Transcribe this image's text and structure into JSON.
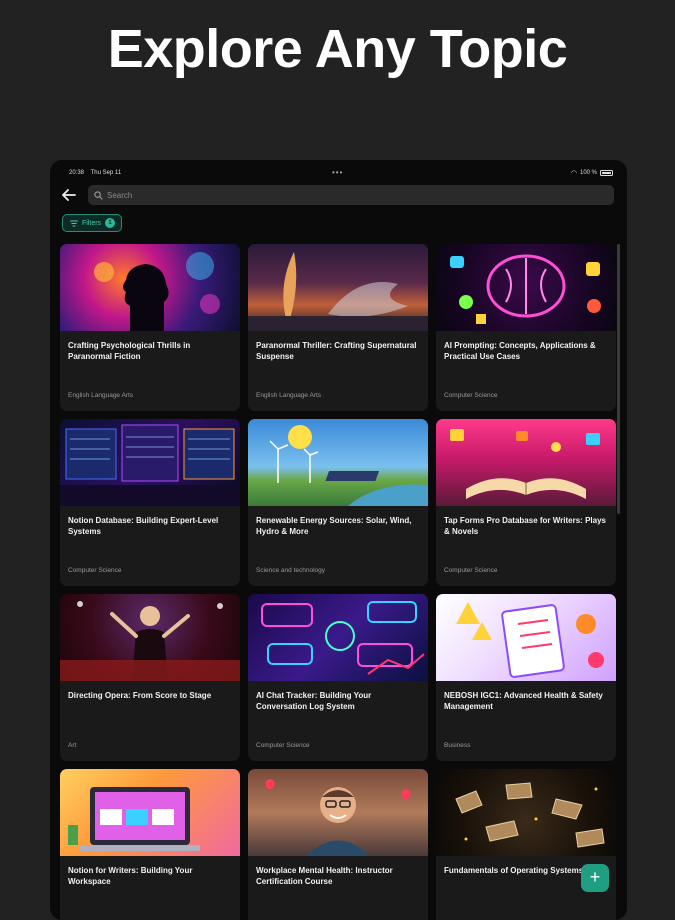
{
  "promo": {
    "headline": "Explore Any Topic"
  },
  "status_bar": {
    "time": "20:38",
    "date": "Thu Sep 11",
    "dots": "•••",
    "battery": "100 %"
  },
  "search": {
    "placeholder": "Search"
  },
  "filters": {
    "label": "Filters",
    "count": "1"
  },
  "colors": {
    "accent": "#1f9e84",
    "card_bg": "#1a1a1a",
    "background": "#0a0a0a"
  },
  "icons": {
    "back": "arrow-left-icon",
    "search": "magnifier-icon",
    "add": "plus-icon"
  },
  "cards": [
    {
      "title": "Crafting Psychological Thrills in Paranormal Fiction",
      "category": "English Language Arts"
    },
    {
      "title": "Paranormal Thriller: Crafting Supernatural Suspense",
      "category": "English Language Arts"
    },
    {
      "title": "AI Prompting: Concepts, Applications & Practical Use Cases",
      "category": "Computer Science"
    },
    {
      "title": "Notion Database: Building Expert-Level Systems",
      "category": "Computer Science"
    },
    {
      "title": "Renewable Energy Sources: Solar, Wind, Hydro & More",
      "category": "Science and technology"
    },
    {
      "title": "Tap Forms Pro Database for Writers: Plays & Novels",
      "category": "Computer Science"
    },
    {
      "title": "Directing Opera: From Score to Stage",
      "category": "Art"
    },
    {
      "title": "AI Chat Tracker: Building Your Conversation Log System",
      "category": "Computer Science"
    },
    {
      "title": "NEBOSH IGC1: Advanced Health & Safety Management",
      "category": "Business"
    },
    {
      "title": "Notion for Writers: Building Your Workspace",
      "category": ""
    },
    {
      "title": "Workplace Mental Health: Instructor Certification Course",
      "category": ""
    },
    {
      "title": "Fundamentals of Operating Systems",
      "category": ""
    }
  ],
  "fab": {
    "label": "+"
  }
}
